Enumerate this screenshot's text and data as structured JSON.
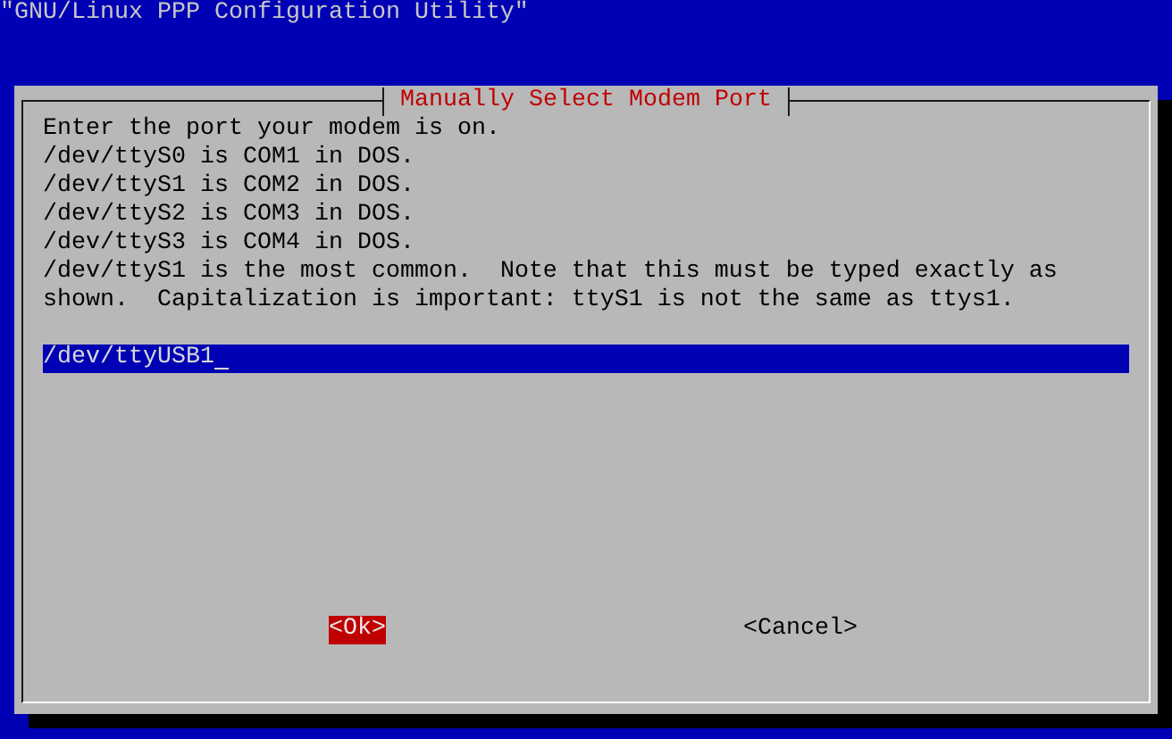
{
  "screen": {
    "title": "\"GNU/Linux PPP Configuration Utility\""
  },
  "dialog": {
    "title": "Manually Select Modem Port",
    "message_lines": [
      "Enter the port your modem is on.",
      "/dev/ttyS0 is COM1 in DOS.",
      "/dev/ttyS1 is COM2 in DOS.",
      "/dev/ttyS2 is COM3 in DOS.",
      "/dev/ttyS3 is COM4 in DOS.",
      "/dev/ttyS1 is the most common.  Note that this must be typed exactly as",
      "shown.  Capitalization is important: ttyS1 is not the same as ttys1."
    ],
    "input": {
      "value": "/dev/ttyUSB1"
    },
    "buttons": [
      {
        "label": "<Ok>",
        "selected": true
      },
      {
        "label": "<Cancel>",
        "selected": false
      }
    ]
  }
}
